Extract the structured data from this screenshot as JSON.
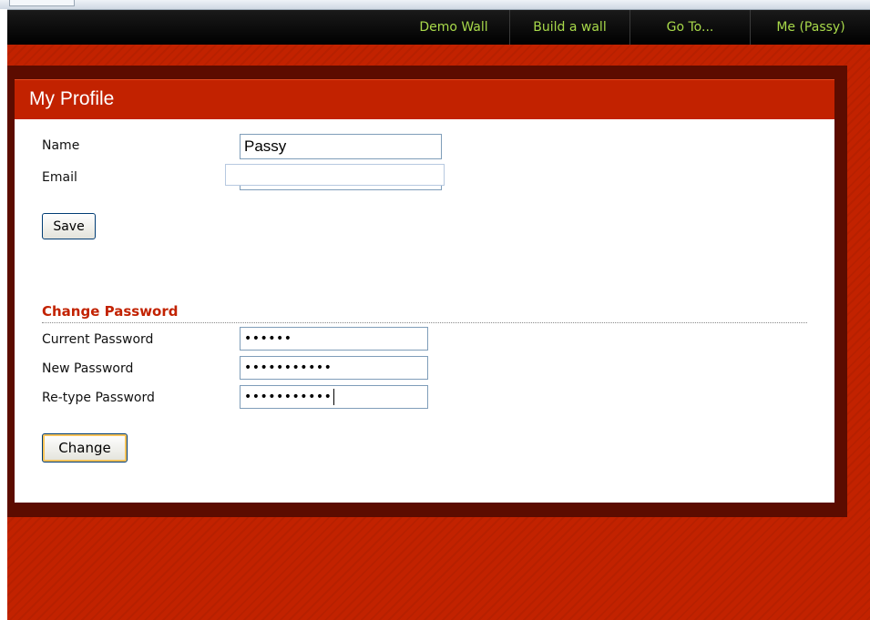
{
  "nav": {
    "items": [
      {
        "label": "Demo Wall"
      },
      {
        "label": "Build a wall"
      },
      {
        "label": "Go To..."
      },
      {
        "label": "Me (Passy)"
      }
    ]
  },
  "profile": {
    "title": "My Profile",
    "name_label": "Name",
    "name_value": "Passy",
    "email_label": "Email",
    "email_value": "",
    "save_label": "Save"
  },
  "password": {
    "section_title": "Change Password",
    "current_label": "Current Password",
    "current_masked": "••••••",
    "new_label": "New Password",
    "new_masked": "•••••••••••",
    "retype_label": "Re-type Password",
    "retype_masked": "•••••••••••",
    "change_label": "Change"
  },
  "colors": {
    "brand_red": "#c22200",
    "dark_red": "#5c0c00",
    "nav_text": "#a8d94a"
  }
}
